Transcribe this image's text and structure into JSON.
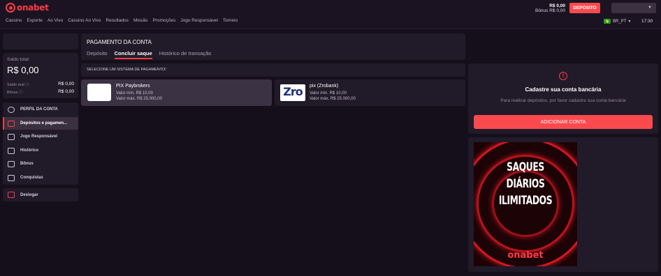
{
  "brand": {
    "logo_text": "onabet",
    "accent": "#ff3b43"
  },
  "nav": [
    "Cassino",
    "Esporte",
    "Ao Vivo",
    "Cassino Ao Vivo",
    "Resultados",
    "Missão",
    "Promoções",
    "Jogo Responsável",
    "Torneio"
  ],
  "header": {
    "balance": "R$ 0,00",
    "bonus": "Bônus R$ 0,00",
    "deposit_label": "DEPÓSITO",
    "language": "BR_PT",
    "time": "17:30"
  },
  "wallet": {
    "total_label": "Saldo total:",
    "total_value": "R$ 0,00",
    "real_label": "Saldo real",
    "real_value": "R$ 0,00",
    "bonus_label": "Bônus",
    "bonus_value": "R$ 0,00"
  },
  "menu": [
    {
      "label": "PERFIL DA CONTA",
      "icon": "user-icon"
    },
    {
      "label": "Depósitos e pagamen...",
      "icon": "wallet-icon"
    },
    {
      "label": "Jogo Responsável",
      "icon": "shield-icon"
    },
    {
      "label": "Histórico",
      "icon": "calendar-icon"
    },
    {
      "label": "Bônus",
      "icon": "gift-icon"
    },
    {
      "label": "Conquistas",
      "icon": "trophy-icon"
    }
  ],
  "logout_label": "Deslogar",
  "main": {
    "title": "PAGAMENTO DA CONTA",
    "tabs": [
      "Depósito",
      "Concluir saque",
      "Histórico de transação"
    ],
    "select_label": "SELECIONE UM SISTEMA DE PAGAMENTO!"
  },
  "payments": [
    {
      "name": "PIX Paybrokers",
      "min": "Valor mín. R$ 10,00",
      "max": "Valor máx. R$ 25.000,00"
    },
    {
      "name": "pix (Zrobank)",
      "min": "Valor mín. R$ 10,00",
      "max": "Valor máx. R$ 25.000,00",
      "logo_text": "Zro"
    }
  ],
  "bank": {
    "title": "Cadastre sua conta bancária",
    "subtitle": "Para realizar depósitos, por favor cadastre sua conta bancária",
    "button": "ADICIONAR CONTA"
  },
  "promo": {
    "line1": "SAQUES",
    "line2": "DIÁRIOS",
    "line3": "ILIMITADOS",
    "logo": "onabet"
  }
}
